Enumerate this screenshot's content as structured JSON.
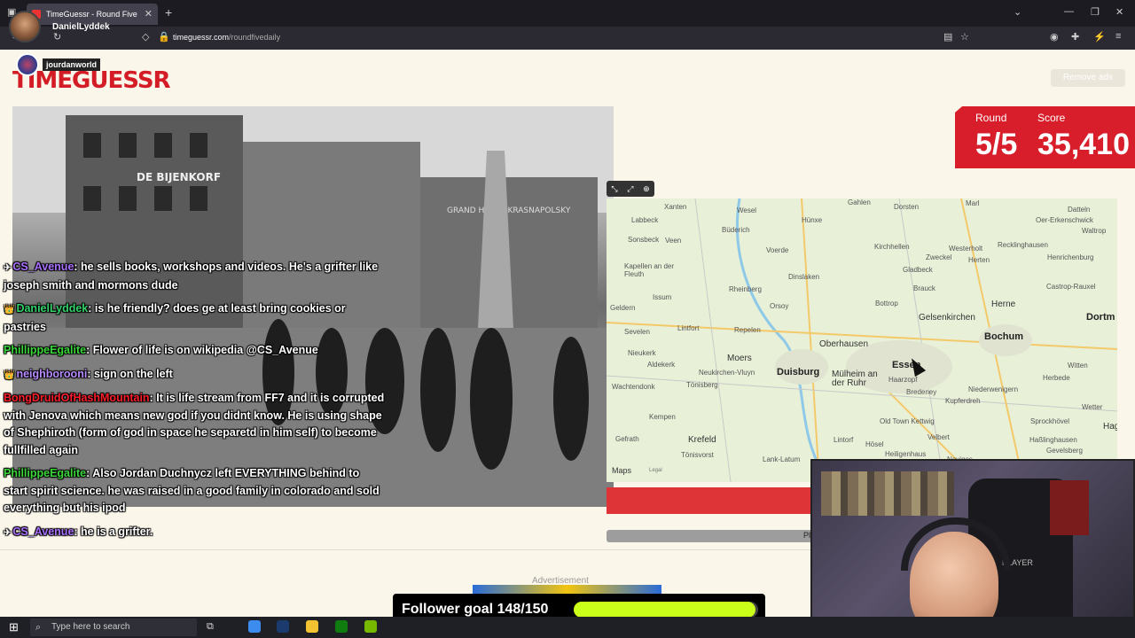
{
  "browser": {
    "tab_title": "TimeGuessr - Round Five",
    "url_domain": "timeguessr.com",
    "url_path": "/roundfivedaily"
  },
  "streamer": {
    "name": "DanielLyddek"
  },
  "page": {
    "logo_text": "TIMEGUESSR",
    "chat_badge_name": "jourdanworld",
    "remove_ads": "Remove ads",
    "round_label": "Round",
    "round_value": "5/5",
    "score_label": "Score",
    "score_value": "35,410",
    "map_brand": "Maps",
    "map_legal": "Legal",
    "play_label": "Pl",
    "ad_label": "Advertisement"
  },
  "photo": {
    "sign_left": "DE BIJENKORF",
    "sign_right": "GRAND HOTEL KRASNAPOLSKY"
  },
  "map": {
    "cities_big": [
      "Essen",
      "Duisburg",
      "Bochum",
      "Gelsenkirchen",
      "Herne",
      "Oberhausen",
      "Moers",
      "Krefeld",
      "Dortm"
    ],
    "cities_small": [
      "Xanten",
      "Wesel",
      "Hünxe",
      "Dorsten",
      "Marl",
      "Datteln",
      "Oer-Erkenschwick",
      "Waltrop",
      "Recklinghausen",
      "Westerholt",
      "Herten",
      "Henrichenburg",
      "Castrop-Rauxel",
      "Sonsbeck",
      "Büderich",
      "Voerde",
      "Dinslaken",
      "Kirchhellen",
      "Zweckel",
      "Gladbeck",
      "Labbeck",
      "Kapellen an der Fleuth",
      "Issum",
      "Rheinberg",
      "Orsoy",
      "Bottrop",
      "Brauck",
      "Geldern",
      "Sevelen",
      "Lintfort",
      "Repelen",
      "Nieukerk",
      "Aldekerk",
      "Wachtendonk",
      "Neukirchen-Vluyn",
      "Tönisberg",
      "Mülheim an der Ruhr",
      "Haarzopf",
      "Bredeney",
      "Kupferdreh",
      "Niederwenigern",
      "Herbede",
      "Witten",
      "Wetter",
      "Kempen",
      "Gefrath",
      "Tönisvorst",
      "Lank-Latum",
      "Lintorf",
      "Hösel",
      "Heiligenhaus",
      "Velbert",
      "Old Town Kettwig",
      "Sprockhövel",
      "Haßlinghausen",
      "Gevelsberg",
      "Neviges",
      "Hag",
      "Gahlen",
      "Veen"
    ]
  },
  "chat": [
    {
      "badge": "✈",
      "user": "CS_Avenue",
      "user_class": "u-purple",
      "text": " he sells books, workshops and videos. He's a grifter like joseph smith and mormons dude"
    },
    {
      "badge": "👑",
      "user": "DanielLyddek",
      "user_class": "u-green",
      "text": " is he friendly? does ge at least bring cookies or pastries"
    },
    {
      "badge": "",
      "user": "PhillippeEgalite",
      "user_class": "u-green2",
      "text": " Flower of life is on wikipedia @CS_Avenue"
    },
    {
      "badge": "👑",
      "user": "neighborooni",
      "user_class": "u-violet",
      "text": " sign on the left"
    },
    {
      "badge": "",
      "user": "BongDruidOfHashMountain",
      "user_class": "u-red",
      "text": " It is life stream from FF7 and it is corrupted with Jenova which means new god if you didnt know. He is using shape of Shephiroth (form of god in space he separetd in him self) to become fullfilled again"
    },
    {
      "badge": "",
      "user": "PhillippeEgalite",
      "user_class": "u-green2",
      "text": " Also Jordan Duchnycz left EVERYTHING behind to start spirit science. he was raised in a good family in colorado and sold everything but his ipod"
    },
    {
      "badge": "✈",
      "user": "CS_Avenue",
      "user_class": "u-purple",
      "text": " he is a grifter."
    }
  ],
  "webcam": {
    "chair_text": "PLAYER"
  },
  "follower_goal": {
    "label": "Follower goal 148/150",
    "current": 148,
    "target": 150
  },
  "taskbar": {
    "search_placeholder": "Type here to search"
  },
  "colors": {
    "brand_red": "#d81e2a",
    "page_bg": "#fbf6ea",
    "goal_green": "#c9ff18"
  }
}
